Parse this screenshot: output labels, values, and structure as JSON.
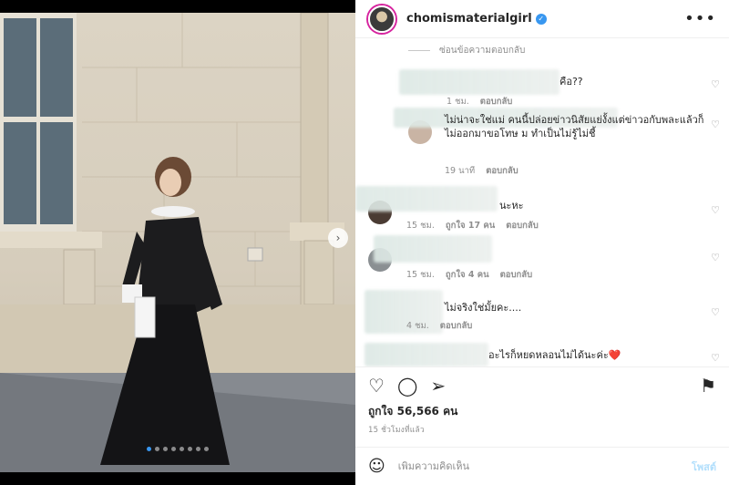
{
  "post": {
    "username": "chomismaterialgirl",
    "verified_icon": "verified-badge-icon",
    "more_label": "•••",
    "carousel_dots": 8,
    "active_dot": 0
  },
  "comments": {
    "hide_replies_label": "ซ่อนข้อความตอบกลับ",
    "items": [
      {
        "text": "คือ??",
        "time": "1 ชม.",
        "likes": "",
        "reply": "ตอบกลับ"
      },
      {
        "text": "ไม่น่าจะใช่แม่ คนนี้ปล่อยข่าวนิสัยแย่งั้งแต่ข่าวอกับพละแล้วก็ไม่ออกมาขอโทษ ม ทำเป็นไม่รู้ไม่ชี้",
        "time": "19 นาที",
        "likes": "",
        "reply": "ตอบกลับ"
      },
      {
        "text": "นะหะ",
        "time": "15 ชม.",
        "likes": "ถูกใจ 17 คน",
        "reply": "ตอบกลับ"
      },
      {
        "text": "",
        "time": "15 ชม.",
        "likes": "ถูกใจ 4 คน",
        "reply": "ตอบกลับ"
      },
      {
        "text": "ไม่จริงใช่มั้ยคะ....",
        "time": "4 ชม.",
        "likes": "",
        "reply": "ตอบกลับ"
      },
      {
        "text": "อะไรก็หยดหลอนไม่ได้นะค่ะ❤️",
        "time": "",
        "likes": "",
        "reply": ""
      }
    ]
  },
  "actions": {
    "like_icon": "heart-icon",
    "comment_icon": "comment-icon",
    "share_icon": "share-icon",
    "save_icon": "bookmark-icon"
  },
  "likes_label": "ถูกใจ 56,566 คน",
  "posted_label": "15 ชั่วโมงที่แล้ว",
  "add_comment": {
    "placeholder": "เพิ่มความคิดเห็น",
    "post_label": "โพสต์"
  },
  "colors": {
    "accent": "#3897f0",
    "post_disabled": "#b2dffc"
  }
}
